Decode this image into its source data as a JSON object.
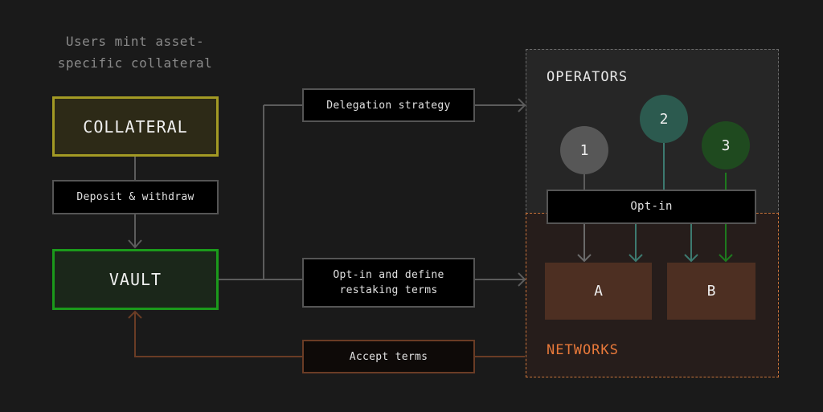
{
  "caption": {
    "line1": "Users mint asset-",
    "line2": "specific collateral"
  },
  "nodes": {
    "collateral": "COLLATERAL",
    "vault": "VAULT"
  },
  "edge_labels": {
    "deposit_withdraw": "Deposit & withdraw",
    "delegation_strategy": "Delegation strategy",
    "optin_define_line1": "Opt-in and define",
    "optin_define_line2": "restaking terms",
    "accept_terms": "Accept terms"
  },
  "operators": {
    "title": "OPERATORS",
    "items": [
      {
        "label": "1",
        "color": "#575757"
      },
      {
        "label": "2",
        "color": "#2c5a4f"
      },
      {
        "label": "3",
        "color": "#1f4a1f"
      }
    ],
    "optin_label": "Opt-in"
  },
  "networks": {
    "title": "NETWORKS",
    "items": [
      {
        "label": "A"
      },
      {
        "label": "B"
      }
    ]
  },
  "colors": {
    "background": "#1a1a1a",
    "collateral_border": "#a39a24",
    "vault_border": "#1b9a1b",
    "networks_accent": "#e8793a",
    "accept_wire": "#6a3c25",
    "neutral_wire": "#5c5c5c",
    "teal_wire": "#3d7a70",
    "green_wire": "#1e7a1e"
  }
}
